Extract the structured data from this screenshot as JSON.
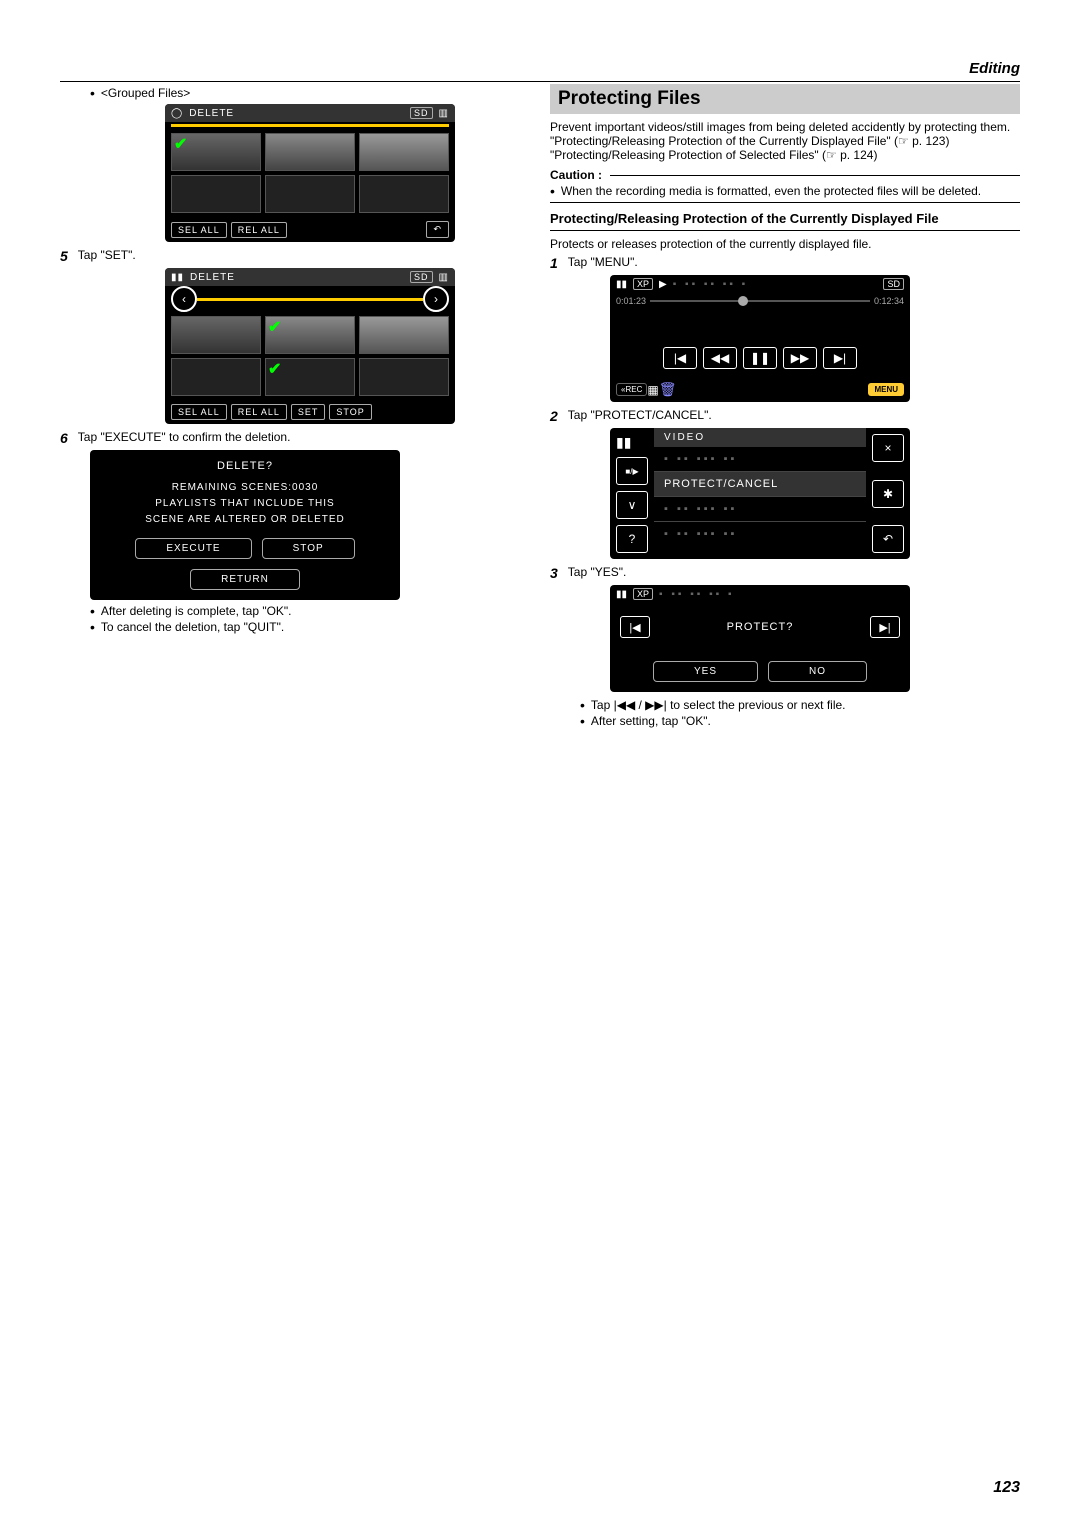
{
  "header": {
    "section": "Editing"
  },
  "left": {
    "grouped_label": "<Grouped Files>",
    "lcd1": {
      "title": "DELETE",
      "selall": "SEL ALL",
      "relall": "REL ALL"
    },
    "step5_num": "5",
    "step5_text": "Tap \"SET\".",
    "lcd2": {
      "title": "DELETE",
      "selall": "SEL ALL",
      "relall": "REL ALL",
      "set": "SET",
      "stop": "STOP"
    },
    "step6_num": "6",
    "step6_text": "Tap \"EXECUTE\" to confirm the deletion.",
    "confirm": {
      "title": "DELETE?",
      "line1": "REMAINING SCENES:0030",
      "line2": "PLAYLISTS THAT INCLUDE THIS",
      "line3": "SCENE ARE ALTERED OR DELETED",
      "execute": "EXECUTE",
      "stop": "STOP",
      "return": "RETURN"
    },
    "after1": "After deleting is complete, tap \"OK\".",
    "after2": "To cancel the deletion, tap \"QUIT\"."
  },
  "right": {
    "title": "Protecting Files",
    "intro": "Prevent important videos/still images from being deleted accidently by protecting them.",
    "ref1": "\"Protecting/Releasing Protection of the Currently Displayed File\" (☞ p. 123)",
    "ref2": "\"Protecting/Releasing Protection of Selected Files\" (☞ p. 124)",
    "caution_label": "Caution :",
    "caution_text": "When the recording media is formatted, even the protected files will be deleted.",
    "sub1": "Protecting/Releasing Protection of the Currently Displayed File",
    "sub1_desc": "Protects or releases protection of the currently displayed file.",
    "step1_num": "1",
    "step1_text": "Tap \"MENU\".",
    "player": {
      "xp": "XP",
      "sd": "SD",
      "t1": "0:01:23",
      "t2": "0:12:34",
      "rec": "«REC",
      "menu": "MENU"
    },
    "step2_num": "2",
    "step2_text": "Tap \"PROTECT/CANCEL\".",
    "menulist": {
      "header": "VIDEO",
      "item_highlight": "PROTECT/CANCEL"
    },
    "step3_num": "3",
    "step3_text": "Tap \"YES\".",
    "protect": {
      "xp": "XP",
      "title": "PROTECT?",
      "yes": "YES",
      "no": "NO"
    },
    "note1a": "Tap ",
    "note1b": " to select the previous or next file.",
    "note2": "After setting, tap \"OK\"."
  },
  "page_num": "123"
}
